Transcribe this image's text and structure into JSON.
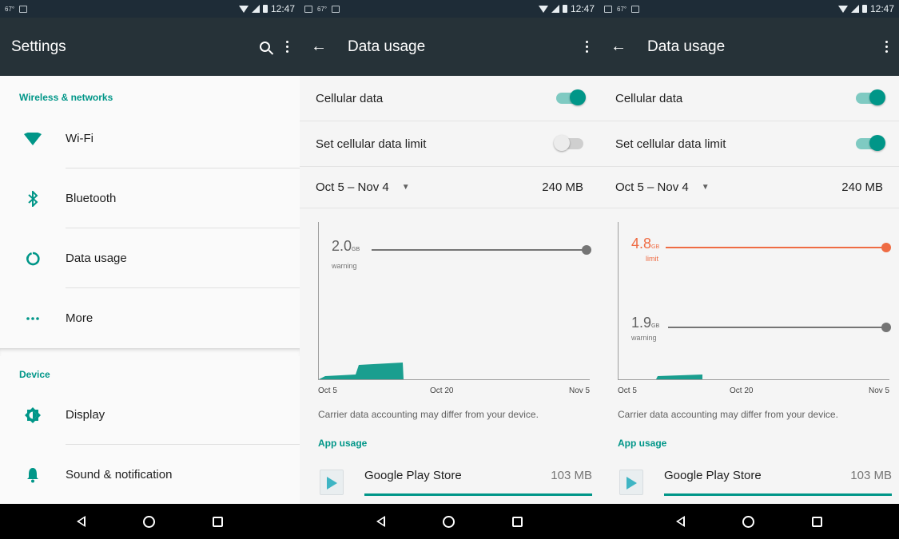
{
  "colors": {
    "accent": "#009688",
    "appbar": "#263238",
    "statusbar": "#1e2c37",
    "limit": "#ef6c44"
  },
  "status": {
    "left_temp": "67°",
    "time": "12:47"
  },
  "settings": {
    "title": "Settings",
    "section_wireless": "Wireless & networks",
    "items_wireless": [
      {
        "label": "Wi-Fi",
        "icon": "wifi-icon"
      },
      {
        "label": "Bluetooth",
        "icon": "bluetooth-icon"
      },
      {
        "label": "Data usage",
        "icon": "data-usage-icon"
      },
      {
        "label": "More",
        "icon": "more-icon"
      }
    ],
    "section_device": "Device",
    "items_device": [
      {
        "label": "Display",
        "icon": "display-icon"
      },
      {
        "label": "Sound & notification",
        "icon": "bell-icon"
      }
    ]
  },
  "data_usage_1": {
    "title": "Data usage",
    "cellular_label": "Cellular data",
    "cellular_on": true,
    "limit_label": "Set cellular data limit",
    "limit_on": false,
    "cycle": "Oct 5 – Nov 4",
    "total": "240 MB",
    "warning_value": "2.0",
    "warning_unit": "GB",
    "warning_label": "warning",
    "x_labels": [
      "Oct 5",
      "Oct 20",
      "Nov 5"
    ],
    "note": "Carrier data accounting may differ from your device.",
    "app_usage_header": "App usage",
    "app_name": "Google Play Store",
    "app_size": "103 MB"
  },
  "data_usage_2": {
    "title": "Data usage",
    "cellular_label": "Cellular data",
    "cellular_on": true,
    "limit_label": "Set cellular data limit",
    "limit_on": true,
    "cycle": "Oct 5 – Nov 4",
    "total": "240 MB",
    "limit_value": "4.8",
    "limit_unit": "GB",
    "limit_text": "limit",
    "warning_value": "1.9",
    "warning_unit": "GB",
    "warning_label": "warning",
    "x_labels": [
      "Oct 5",
      "Oct 20",
      "Nov 5"
    ],
    "note": "Carrier data accounting may differ from your device.",
    "app_usage_header": "App usage",
    "app_name": "Google Play Store",
    "app_size": "103 MB"
  }
}
